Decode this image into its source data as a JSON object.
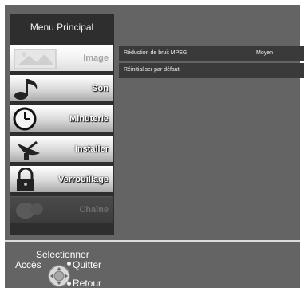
{
  "menu": {
    "title": "Menu Principal",
    "items": [
      {
        "label": "Image",
        "icon": "image-icon",
        "state": "selected"
      },
      {
        "label": "Son",
        "icon": "music-note-icon",
        "state": "normal"
      },
      {
        "label": "Minuterie",
        "icon": "clock-icon",
        "state": "normal"
      },
      {
        "label": "Installer",
        "icon": "satellite-dish-icon",
        "state": "normal"
      },
      {
        "label": "Verrouillage",
        "icon": "padlock-icon",
        "state": "normal"
      },
      {
        "label": "Chaîne",
        "icon": "channel-icon",
        "state": "disabled"
      }
    ]
  },
  "settings": [
    {
      "name": "Réduction de bruit MPEG",
      "value": "Moyen"
    },
    {
      "name": "Réinitialiser par défaut",
      "value": ""
    }
  ],
  "help": {
    "select": "Sélectionner",
    "access": "Accès",
    "quit": "Quitter",
    "back": "Retour",
    "nav_icon": "navigation-pad-icon"
  }
}
